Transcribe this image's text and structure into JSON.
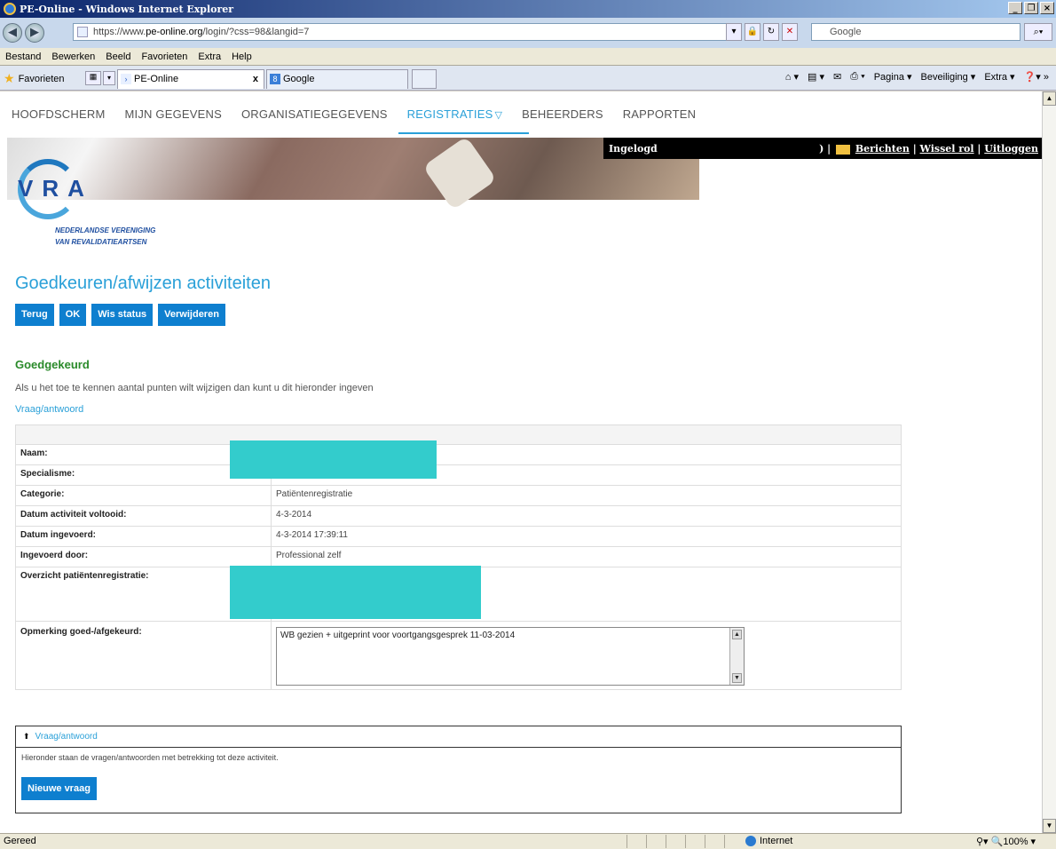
{
  "window": {
    "title": "PE-Online - Windows Internet Explorer",
    "buttons": [
      "_",
      "̸",
      "X"
    ]
  },
  "address": {
    "url_prefix": "https://www.",
    "url_host": "pe-online.org",
    "url_path": "/login/?css=98&langid=7",
    "search_placeholder": "Google"
  },
  "menu": [
    "Bestand",
    "Bewerken",
    "Beeld",
    "Favorieten",
    "Extra",
    "Help"
  ],
  "favbar": {
    "favorites_label": "Favorieten",
    "tabs": [
      {
        "label": "PE-Online",
        "close": "x"
      },
      {
        "label": "Google"
      }
    ],
    "tools": [
      "Pagina ▾",
      "Beveiliging ▾",
      "Extra ▾"
    ]
  },
  "nav": {
    "items": [
      "HOOFDSCHERM",
      "MIJN GEGEVENS",
      "ORGANISATIEGEGEVENS",
      "REGISTRATIES",
      "BEHEERDERS",
      "RAPPORTEN"
    ],
    "active": "REGISTRATIES"
  },
  "loginbar": {
    "label": "Ingelogd",
    "sep": ") |",
    "messages": "Berichten",
    "switch_role": "Wissel rol",
    "logout": "Uitloggen"
  },
  "logo": {
    "letters": "VRA",
    "line1": "NEDERLANDSE VERENIGING",
    "line2": "VAN REVALIDATIEARTSEN"
  },
  "page": {
    "title": "Goedkeuren/afwijzen activiteiten",
    "buttons": [
      "Terug",
      "OK",
      "Wis status",
      "Verwijderen"
    ],
    "status_heading": "Goedgekeurd",
    "intro": "Als u het toe te kennen aantal punten wilt wijzigen dan kunt u dit hieronder ingeven",
    "qa_link": "Vraag/antwoord"
  },
  "detail": {
    "rows": [
      {
        "key": "Naam:",
        "value": ""
      },
      {
        "key": "Specialisme:",
        "value": ""
      },
      {
        "key": "Categorie:",
        "value": "Patiëntenregistratie"
      },
      {
        "key": "Datum activiteit voltooid:",
        "value": "4-3-2014"
      },
      {
        "key": "Datum ingevoerd:",
        "value": "4-3-2014 17:39:11"
      },
      {
        "key": "Ingevoerd door:",
        "value": "Professional zelf"
      },
      {
        "key": "Overzicht patiëntenregistratie:",
        "value": ""
      }
    ],
    "remark_key": "Opmerking goed-/afgekeurd:",
    "remark_value": "WB gezien + uitgeprint voor voortgangsgesprek 11-03-2014"
  },
  "qa": {
    "heading": "Vraag/antwoord",
    "text": "Hieronder staan de vragen/antwoorden met betrekking tot deze activiteit.",
    "new_button": "Nieuwe vraag"
  },
  "statusbar": {
    "status": "Gereed",
    "zone": "Internet",
    "zoom": "100%"
  },
  "colors": {
    "accent": "#2aa0d8",
    "button": "#0e7fcf",
    "approved": "#2a8a2a",
    "redaction": "#33cccc"
  }
}
